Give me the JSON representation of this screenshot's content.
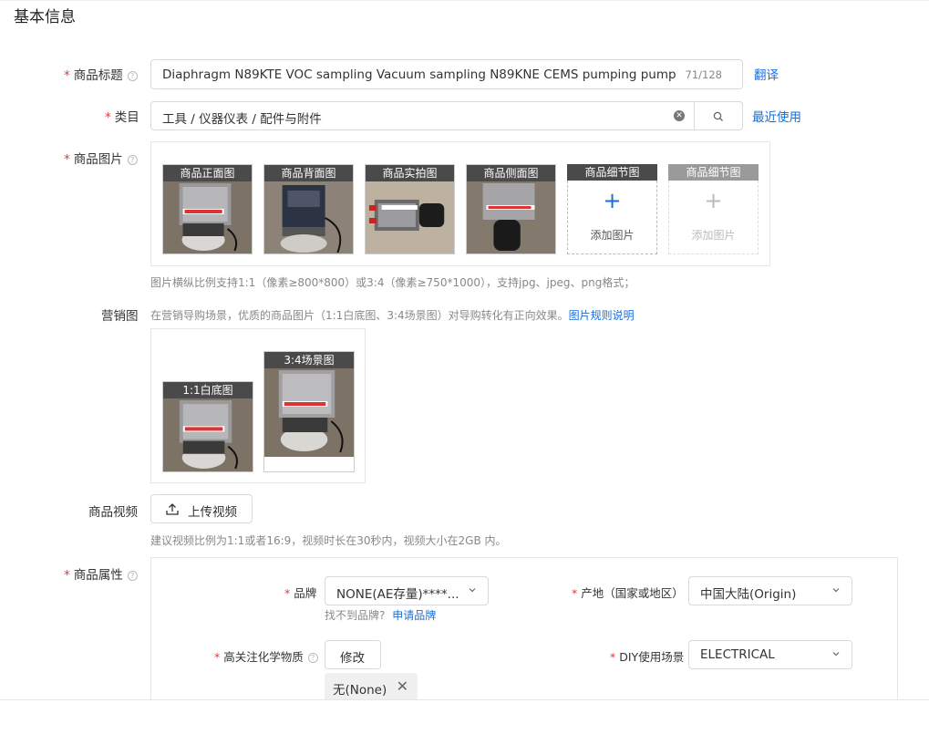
{
  "section_title": "基本信息",
  "title_field": {
    "label": "商品标题",
    "value": "Diaphragm N89KTE VOC sampling  Vacuum sampling N89KNE CEMS pumping pump",
    "counter": "71/128",
    "translate_link": "翻译"
  },
  "category_field": {
    "label": "类目",
    "value": "工具 / 仪器仪表 / 配件与附件",
    "recent_link": "最近使用"
  },
  "images_field": {
    "label": "商品图片",
    "slots": [
      {
        "caption": "商品正面图",
        "filled": true
      },
      {
        "caption": "商品背面图",
        "filled": true
      },
      {
        "caption": "商品实拍图",
        "filled": true
      },
      {
        "caption": "商品侧面图",
        "filled": true
      },
      {
        "caption": "商品细节图",
        "filled": false,
        "add_label": "添加图片"
      },
      {
        "caption": "商品细节图",
        "filled": false,
        "add_label": "添加图片"
      }
    ],
    "hint": "图片横纵比例支持1:1（像素≥800*800）或3:4（像素≥750*1000），支持jpg、jpeg、png格式；"
  },
  "marketing_field": {
    "label": "营销图",
    "hint": "在营销导购场景，优质的商品图片（1:1白底图、3:4场景图）对导购转化有正向效果。",
    "rules_link": "图片规则说明",
    "images": [
      {
        "caption": "1:1白底图"
      },
      {
        "caption": "3:4场景图"
      }
    ]
  },
  "video_field": {
    "label": "商品视频",
    "upload_label": "上传视频",
    "hint": "建议视频比例为1:1或者16:9，视频时长在30秒内，视频大小在2GB 内。"
  },
  "attributes_field": {
    "label": "商品属性",
    "brand": {
      "label": "品牌",
      "value": "NONE(AE存量)****...",
      "missing_text": "找不到品牌?",
      "apply_link": "申请品牌"
    },
    "origin": {
      "label": "产地（国家或地区）",
      "value": "中国大陆(Origin)"
    },
    "chemical": {
      "label": "高关注化学物质",
      "modify_label": "修改",
      "tag_value": "无(None)"
    },
    "diy_scene": {
      "label": "DIY使用场景",
      "value": "ELECTRICAL"
    }
  },
  "required_mark": "*",
  "colors": {
    "accent": "#1a6fd6",
    "required": "#e4393c",
    "caption_bg": "#4a4a4a"
  }
}
